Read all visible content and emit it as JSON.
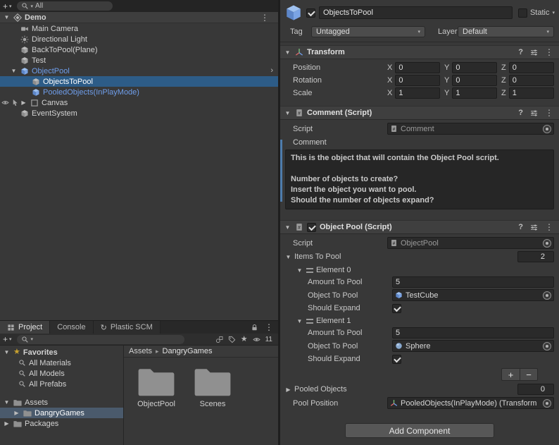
{
  "icons": {
    "caret": "▾",
    "foldout_open": "▼",
    "foldout_closed": "▶",
    "kebab": "⋮",
    "plus": "+",
    "minus": "−",
    "help": "?",
    "crumb_sep": "▸",
    "prefab_chevron": "›",
    "star": "★",
    "refresh": "↻"
  },
  "colors": {
    "selection": "#2d5c87",
    "prefab_text": "#6f9eeb",
    "accent_strip": "#4e7cac"
  },
  "hierarchy": {
    "search_value": "All",
    "scene_name": "Demo",
    "items": [
      {
        "label": "Main Camera"
      },
      {
        "label": "Directional Light"
      },
      {
        "label": "BackToPool(Plane)"
      },
      {
        "label": "Test"
      },
      {
        "label": "ObjectPool"
      },
      {
        "label": "ObjectsToPool"
      },
      {
        "label": "PooledObjects(InPlayMode)"
      },
      {
        "label": "Canvas"
      },
      {
        "label": "EventSystem"
      }
    ]
  },
  "project": {
    "tabs": [
      {
        "label": "Project"
      },
      {
        "label": "Console"
      },
      {
        "label": "Plastic SCM"
      }
    ],
    "hidden_count": "11",
    "favorites_title": "Favorites",
    "favorites": [
      {
        "label": "All Materials"
      },
      {
        "label": "All Models"
      },
      {
        "label": "All Prefabs"
      }
    ],
    "tree": [
      {
        "label": "Assets"
      },
      {
        "label": "DangryGames"
      },
      {
        "label": "Packages"
      }
    ],
    "breadcrumb": [
      {
        "label": "Assets"
      },
      {
        "label": "DangryGames"
      }
    ],
    "folders": [
      {
        "label": "ObjectPool"
      },
      {
        "label": "Scenes"
      }
    ]
  },
  "inspector": {
    "name": "ObjectsToPool",
    "static_label": "Static",
    "tag_label": "Tag",
    "tag_value": "Untagged",
    "layer_label": "Layer",
    "layer_value": "Default",
    "transform": {
      "title": "Transform",
      "axis": {
        "x": "X",
        "y": "Y",
        "z": "Z"
      },
      "rows": [
        {
          "label": "Position",
          "x": "0",
          "y": "0",
          "z": "0"
        },
        {
          "label": "Rotation",
          "x": "0",
          "y": "0",
          "z": "0"
        },
        {
          "label": "Scale",
          "x": "1",
          "y": "1",
          "z": "1"
        }
      ]
    },
    "comment": {
      "title": "Comment (Script)",
      "script_label": "Script",
      "script_value": "Comment",
      "label": "Comment",
      "lines": [
        "This is the object that will contain the Object Pool script.",
        "",
        "Number of objects to create?",
        "Insert the object you want to pool.",
        "Should the number of objects expand?"
      ]
    },
    "pool": {
      "title": "Object Pool (Script)",
      "script_label": "Script",
      "script_value": "ObjectPool",
      "items_label": "Items To Pool",
      "items_count": "2",
      "elements": [
        {
          "title": "Element 0",
          "amount_label": "Amount To Pool",
          "amount": "5",
          "object_label": "Object To Pool",
          "object": "TestCube",
          "expand_label": "Should Expand"
        },
        {
          "title": "Element 1",
          "amount_label": "Amount To Pool",
          "amount": "5",
          "object_label": "Object To Pool",
          "object": "Sphere",
          "expand_label": "Should Expand"
        }
      ],
      "pooled_label": "Pooled Objects",
      "pooled_value": "0",
      "position_label": "Pool Position",
      "position_value": "PooledObjects(InPlayMode) (Transform"
    },
    "add_component": "Add Component"
  }
}
